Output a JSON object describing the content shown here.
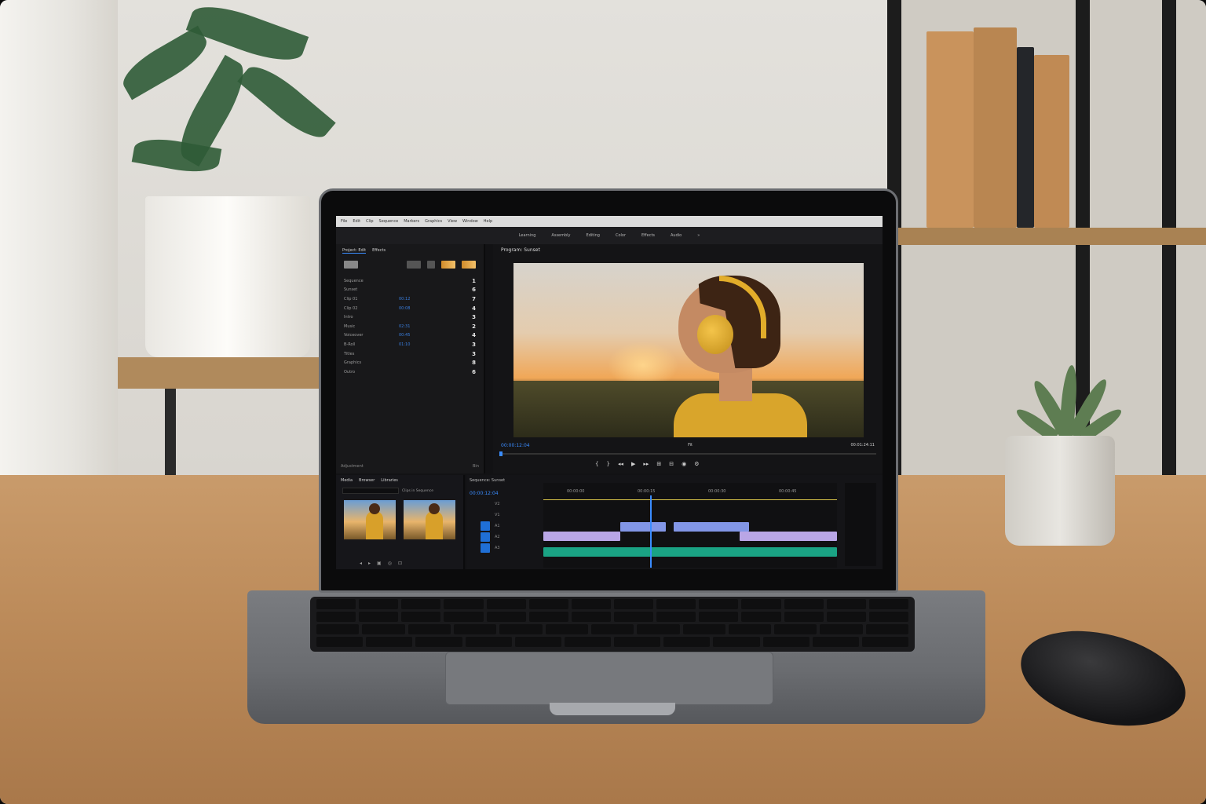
{
  "app": {
    "menu": [
      "File",
      "Edit",
      "Clip",
      "Sequence",
      "Markers",
      "Graphics",
      "View",
      "Window",
      "Help"
    ],
    "workspaces": [
      "Learning",
      "Assembly",
      "Editing",
      "Color",
      "Effects",
      "Audio",
      "»"
    ]
  },
  "project_panel": {
    "tabs": [
      "Project: Edit",
      "Effects"
    ],
    "files": [
      {
        "name": "Sequence",
        "value": "",
        "count": "1"
      },
      {
        "name": "Sunset",
        "value": "",
        "count": "6"
      },
      {
        "name": "Clip 01",
        "value": "00:12",
        "count": "7"
      },
      {
        "name": "Clip 02",
        "value": "00:08",
        "count": "4"
      },
      {
        "name": "Intro",
        "value": "",
        "count": "3"
      },
      {
        "name": "Music",
        "value": "02:31",
        "count": "2"
      },
      {
        "name": "Voiceover",
        "value": "00:45",
        "count": "4"
      },
      {
        "name": "B-Roll",
        "value": "01:10",
        "count": "3"
      },
      {
        "name": "Titles",
        "value": "",
        "count": "3"
      },
      {
        "name": "Graphics",
        "value": "",
        "count": "8"
      },
      {
        "name": "Outro",
        "value": "",
        "count": "6"
      }
    ],
    "footer_left": "Adjustment",
    "footer_right": "Bin"
  },
  "program_monitor": {
    "title": "Program: Sunset",
    "timecode": "00:00:12:04",
    "fit": "Fit",
    "end_timecode": "00:01:24:11"
  },
  "media_panel": {
    "tabs": [
      "Media",
      "Browser",
      "Libraries"
    ],
    "search_hint": "Clips in Sequence"
  },
  "timeline": {
    "title": "Sequence: Sunset",
    "timecode": "00:00:12:04",
    "ruler": [
      "00:00:00",
      "00:00:15",
      "00:00:30",
      "00:00:45"
    ],
    "tracks": [
      "V2",
      "V1",
      "A1",
      "A2",
      "A3"
    ]
  }
}
